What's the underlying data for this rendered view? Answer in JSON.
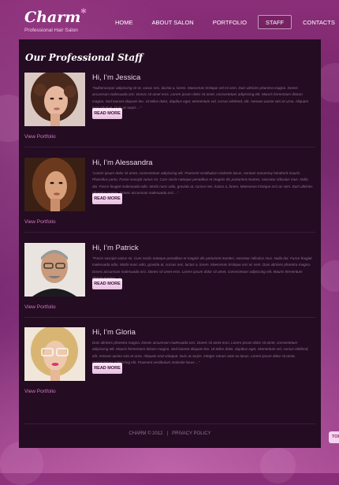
{
  "site": {
    "logo_name": "Charm",
    "logo_star": "*",
    "tagline": "Professional Hair Salon"
  },
  "nav": {
    "items": [
      {
        "label": "HOME",
        "active": false
      },
      {
        "label": "ABOUT SALON",
        "active": false
      },
      {
        "label": "PORTFOLIO",
        "active": false
      },
      {
        "label": "STAFF",
        "active": true
      },
      {
        "label": "CONTACTS",
        "active": false
      }
    ]
  },
  "main": {
    "title": "Our Professional Staff",
    "members": [
      {
        "name": "Hi, I’m Jessica",
        "bio": "“Nullamcorper adipiscing vit et, varius nec, lacinia a, lorem. Maecenas tristique vel mi sem. Duis ultricies pharetra magna. Donec accumsan malesuada orci. Donec sit amet eros. Lorem ipsum dolor sit amet, consectetuer adipiscing elit. Mauris fermentum dictum magna. Sed laoreet aliquam leo. Ut tellus dolor, dapibus eget, elementum vel, cursus eleifend, elit. Aenean auctor wisi et urna. Aliquam erat volutpat. Duis ac turpis ...”",
        "button": "READ MORE",
        "link": "View Portfolio"
      },
      {
        "name": "Hi, I’m Alessandra",
        "bio": "“Lorem ipsum dolor sit amet, consectetuer adipiscing elit. Praesent vestibulum molestie lacus. Aenean nonummy hendrerit mauris. Phasellus porta. Fusce suscipit varius mi. Cum sociis natoque penatibus et magnis dis parturient montes, nascetur ridiculus mus. Nulla dui. Fusce feugiat malesuada odio. Morbi nunc odio, gravida at, cursus nec, luctus a, lorem. Maecenas tristique orci ac sem. Duis ultricies pharetra magna. Donec accumsan malesuada orci ...”",
        "button": "READ MORE",
        "link": "View Portfolio"
      },
      {
        "name": "Hi, I’m Patrick",
        "bio": "“Fusce suscipit varius mi. Cum sociis natoque penatibus et magnis dis parturient montes, nascetur ridiculus mus. Nulla dui. Fusce feugiat malesuada odio. Morbi nunc odio, gravida at, cursus nec, luctus a, lorem. Maecenas tristique orci ac sem. Duis ultricies pharetra magna. Donec accumsan malesuada orci. Donec sit amet eros. Lorem ipsum dolor sit amet, consectetuer adipiscing elit. Mauris fermentum dictum magna ...”",
        "button": "READ MORE",
        "link": "View Portfolio"
      },
      {
        "name": "Hi, I’m Gloria",
        "bio": "Duis ultricies pharetra magna. Donec accumsan malesuada orci. Donec sit amet eros. Lorem ipsum dolor sit amet, consectetuer adipiscing elit. Mauris fermentum dictum magna. Sed laoreet aliquam leo. Ut tellus dolor, dapibus eget, elementum vel, cursus eleifend, elit. Aenean auctor wisi et urna. Aliquam erat volutpat. Duis ac turpis. Integer rutrum ante eu lacus. Lorem ipsum dolor sit amet, consectetuer adipiscing elit. Praesent vestibulum molestie lacus ...”",
        "button": "READ MORE",
        "link": "View Portfolio"
      }
    ]
  },
  "footer": {
    "copyright": "CHARM © 2012",
    "separator": "|",
    "privacy": "PRIVACY POLICY"
  },
  "totop": {
    "label": "TOP"
  },
  "colors": {
    "background": "#7a2a72",
    "panel": "#240c22",
    "accent_link": "#cf79bf",
    "button_bg": "#f3d3ec"
  }
}
